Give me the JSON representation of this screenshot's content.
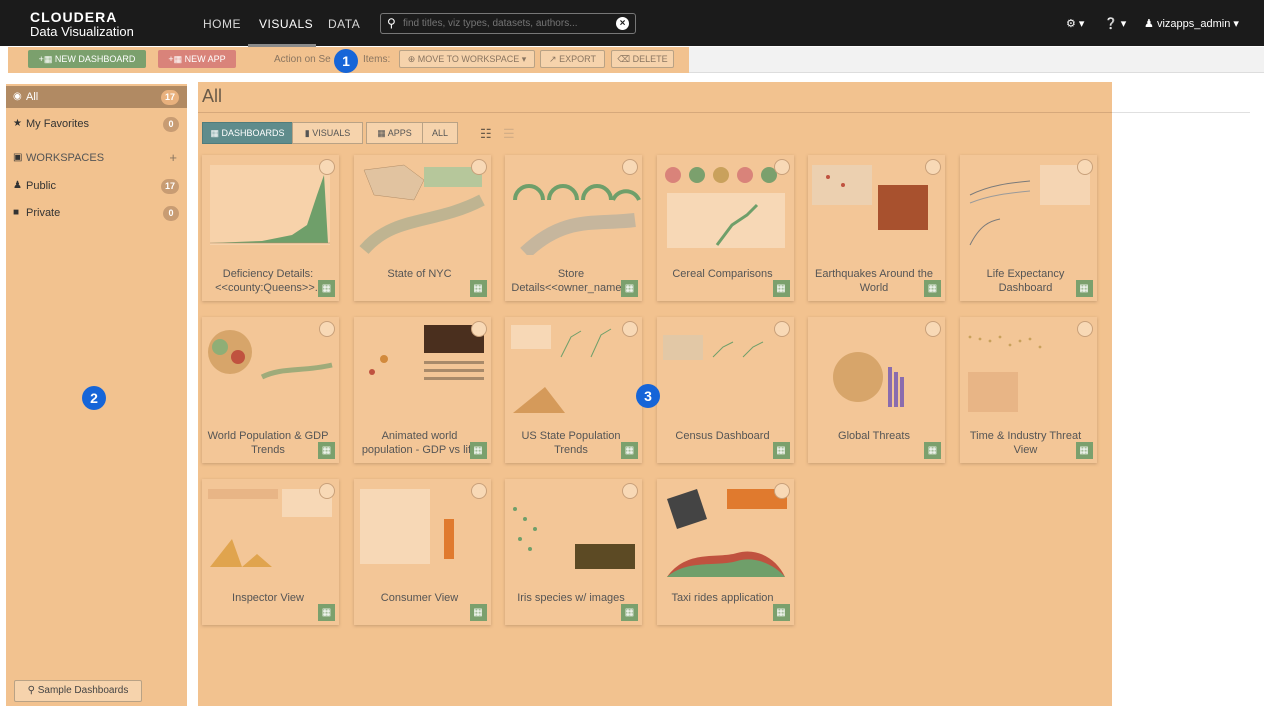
{
  "app": {
    "brand": "CLOUDERA",
    "product": "Data Visualization"
  },
  "nav": {
    "home": "HOME",
    "visuals": "VISUALS",
    "data": "DATA",
    "search_placeholder": "find titles, viz types, datasets, authors...",
    "user": "vizapps_admin"
  },
  "actions": {
    "new_dashboard": "NEW DASHBOARD",
    "new_app": "NEW APP",
    "action_label_left": "Action on Se",
    "action_label_right": "Items:",
    "move_to_workspace": "MOVE TO WORKSPACE",
    "export": "EXPORT",
    "delete": "DELETE"
  },
  "callouts": [
    "1",
    "2",
    "3"
  ],
  "sidebar": {
    "all": {
      "label": "All",
      "count": "17"
    },
    "favorites": {
      "label": "My Favorites",
      "count": "0"
    },
    "workspaces": "WORKSPACES",
    "public": {
      "label": "Public",
      "count": "17"
    },
    "private": {
      "label": "Private",
      "count": "0"
    },
    "sample": "Sample Dashboards"
  },
  "main": {
    "title": "All",
    "filters": {
      "dashboards": "DASHBOARDS",
      "visuals": "VISUALS",
      "apps": "APPS",
      "all": "ALL"
    }
  },
  "cards": [
    {
      "title": "Deficiency Details: <<county:Queens>>..",
      "thumb": "area"
    },
    {
      "title": "State of NYC",
      "thumb": "map"
    },
    {
      "title": "Store Details<<owner_name:..",
      "thumb": "gauge"
    },
    {
      "title": "Cereal Comparisons",
      "thumb": "pies"
    },
    {
      "title": "Earthquakes Around the World",
      "thumb": "quake"
    },
    {
      "title": "Life Expectancy Dashboard",
      "thumb": "lines"
    },
    {
      "title": "World Population & GDP Trends",
      "thumb": "bubbles"
    },
    {
      "title": "Animated world population - GDP vs life",
      "thumb": "text"
    },
    {
      "title": "US State Population Trends",
      "thumb": "multi"
    },
    {
      "title": "Census Dashboard",
      "thumb": "census"
    },
    {
      "title": "Global Threats",
      "thumb": "threats"
    },
    {
      "title": "Time & Industry Threat View",
      "thumb": "dots"
    },
    {
      "title": "Inspector View",
      "thumb": "inspector"
    },
    {
      "title": "Consumer View",
      "thumb": "table"
    },
    {
      "title": "Iris species w/ images",
      "thumb": "scatter"
    },
    {
      "title": "Taxi rides application",
      "thumb": "taxi"
    }
  ]
}
